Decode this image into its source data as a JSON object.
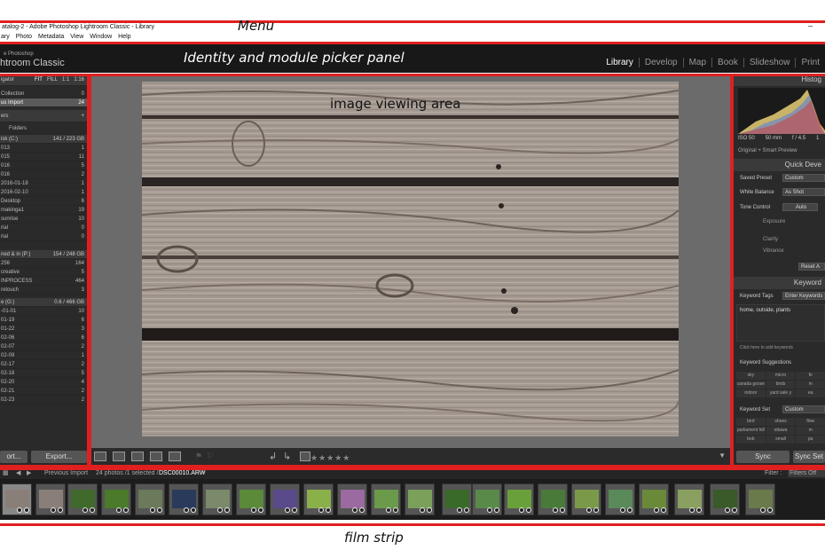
{
  "annotations": {
    "menu": "Menu",
    "identity": "Identity and module picker panel",
    "image": "image viewing area",
    "filmstrip": "film strip"
  },
  "window": {
    "title": "atalog-2 - Adobe Photoshop Lightroom Classic - Library",
    "minimize": "–"
  },
  "menu": [
    "ary",
    "Photo",
    "Metadata",
    "View",
    "Window",
    "Help"
  ],
  "identity": {
    "brand_small": "e Photoshop",
    "brand_big": "htroom Classic",
    "modules": [
      "Library",
      "Develop",
      "Map",
      "Book",
      "Slideshow",
      "Print"
    ],
    "active_module": "Library"
  },
  "left_panel": {
    "navigator": {
      "label": "igator",
      "zoom_options": [
        "FIT",
        "FILL",
        "1:1",
        "1:16"
      ]
    },
    "catalog": [
      {
        "label": "Collection",
        "count": "0"
      },
      {
        "label": "us Import",
        "count": "24"
      }
    ],
    "folders_header": "ers",
    "folders_add": "+",
    "folders_button": "Folders",
    "volume1": {
      "label": "isk (C:)",
      "info": "141 / 223 GB"
    },
    "folders_c": [
      {
        "label": "013",
        "count": "1"
      },
      {
        "label": "015",
        "count": "11"
      },
      {
        "label": "016",
        "count": "5"
      },
      {
        "label": "016",
        "count": "2"
      },
      {
        "label": "2016-01-18",
        "count": "1"
      },
      {
        "label": "2016-02-10",
        "count": "1"
      },
      {
        "label": "Desktop",
        "count": "6"
      },
      {
        "label": "makinga1",
        "count": "19"
      },
      {
        "label": "sunrise",
        "count": "10"
      },
      {
        "label": "rial",
        "count": "0"
      },
      {
        "label": "rial",
        "count": "0"
      }
    ],
    "volume2": {
      "label": "ned & in (P:)",
      "info": "154 / 248 GB"
    },
    "folders_p": [
      {
        "label": "256",
        "count": "164"
      },
      {
        "label": "creative",
        "count": "5"
      },
      {
        "label": "INPROCESS",
        "count": "464"
      },
      {
        "label": "retouch",
        "count": "3"
      }
    ],
    "volume3": {
      "label": "e (G:)",
      "info": "0.6 / 466 GB"
    },
    "folders_g": [
      {
        "label": "-01-01",
        "count": "10"
      },
      {
        "label": "01-19",
        "count": "6"
      },
      {
        "label": "01-22",
        "count": "3"
      },
      {
        "label": "02-06",
        "count": "6"
      },
      {
        "label": "02-07",
        "count": "2"
      },
      {
        "label": "02-09",
        "count": "1"
      },
      {
        "label": "02-17",
        "count": "2"
      },
      {
        "label": "02-18",
        "count": "5"
      },
      {
        "label": "02-20",
        "count": "4"
      },
      {
        "label": "02-21",
        "count": "2"
      },
      {
        "label": "02-23",
        "count": "2"
      }
    ],
    "import_button": "ort...",
    "export_button": "Export..."
  },
  "toolbar": {
    "stars": "★★★★★"
  },
  "right_panel": {
    "histogram_title": "Histog",
    "hist_info": [
      "ISO 50",
      "50 mm",
      "f / 4.5",
      "1"
    ],
    "preview_label": "Original + Smart Preview",
    "quick_develop": "Quick Deve",
    "saved_preset_label": "Saved Preset",
    "saved_preset_value": "Custom",
    "white_balance_label": "White Balance",
    "white_balance_value": "As Shot",
    "tone_control_label": "Tone Control",
    "tone_control_value": "Auto",
    "exposure_label": "Exposure",
    "clarity_label": "Clarity",
    "vibrance_label": "Vibrance",
    "reset_label": "Reset A",
    "keywording": "Keyword",
    "keyword_tags_label": "Keyword Tags",
    "keyword_tags_value": "Enter Keywords",
    "keywords_text": "home, outside, plants",
    "click_to_add": "Click here to add keywords",
    "suggestions_label": "Keyword Suggestions",
    "suggestions": [
      "sky",
      "micro",
      "fe",
      "canada goose",
      "birds",
      "m",
      "indoor",
      "yard sale y",
      "ea"
    ],
    "keyword_set_label": "Keyword Set",
    "keyword_set_value": "Custom",
    "keyword_set_items": [
      "bird",
      "shoes",
      "flow",
      "parliament hill",
      "ottawa",
      "m",
      "bob",
      "small",
      "pa"
    ],
    "sync_button": "Sync",
    "sync_settings_button": "Sync Set"
  },
  "filmstrip_bar": {
    "source": "Previous Import",
    "info": "24 photos /1 selected /",
    "filename": "DSC00010.ARW",
    "filter_label": "Filter :",
    "filter_value": "Filters Off"
  },
  "colors": {
    "annotation_red": "#e02020",
    "panel_bg": "#2a2a2a",
    "center_bg": "#6b6b6b",
    "identity_bg": "#181818"
  }
}
